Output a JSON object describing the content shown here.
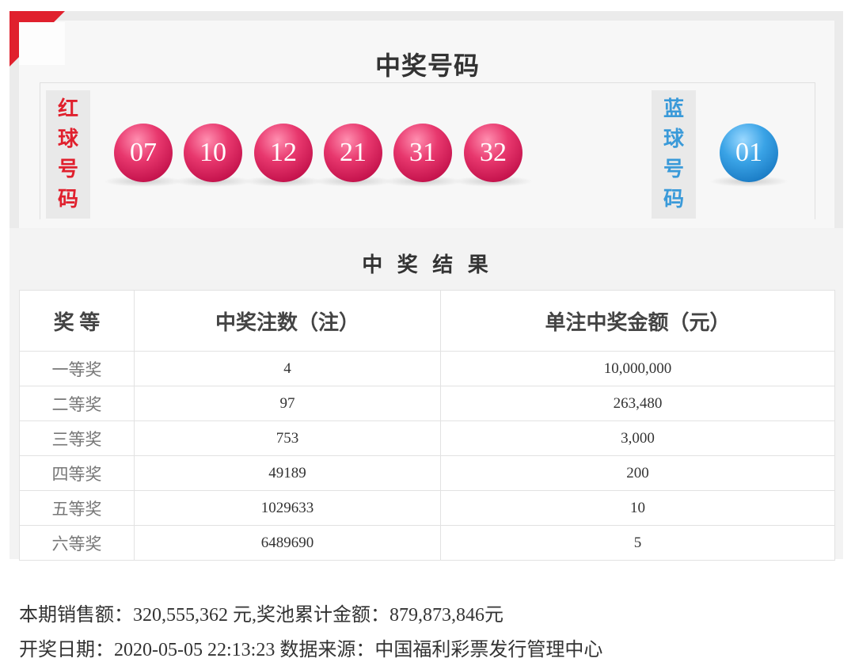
{
  "header": {
    "title": "中奖号码"
  },
  "red_label_chars": [
    "红",
    "球",
    "号",
    "码"
  ],
  "blue_label_chars": [
    "蓝",
    "球",
    "号",
    "码"
  ],
  "red_balls": [
    "07",
    "10",
    "12",
    "21",
    "31",
    "32"
  ],
  "blue_ball": "01",
  "results": {
    "title": "中 奖 结 果",
    "columns": [
      "奖 等",
      "中奖注数（注）",
      "单注中奖金额（元）"
    ],
    "rows": [
      {
        "level": "一等奖",
        "count": "4",
        "amount": "10,000,000"
      },
      {
        "level": "二等奖",
        "count": "97",
        "amount": "263,480"
      },
      {
        "level": "三等奖",
        "count": "753",
        "amount": "3,000"
      },
      {
        "level": "四等奖",
        "count": "49189",
        "amount": "200"
      },
      {
        "level": "五等奖",
        "count": "1029633",
        "amount": "10"
      },
      {
        "level": "六等奖",
        "count": "6489690",
        "amount": "5"
      }
    ]
  },
  "footer": {
    "sales_line": "本期销售额：320,555,362 元,奖池累计金额：879,873,846元",
    "date_line": "开奖日期：2020-05-05 22:13:23 数据来源：中国福利彩票发行管理中心"
  },
  "colors": {
    "red": "#e0202d",
    "blue": "#3a9ad9"
  }
}
